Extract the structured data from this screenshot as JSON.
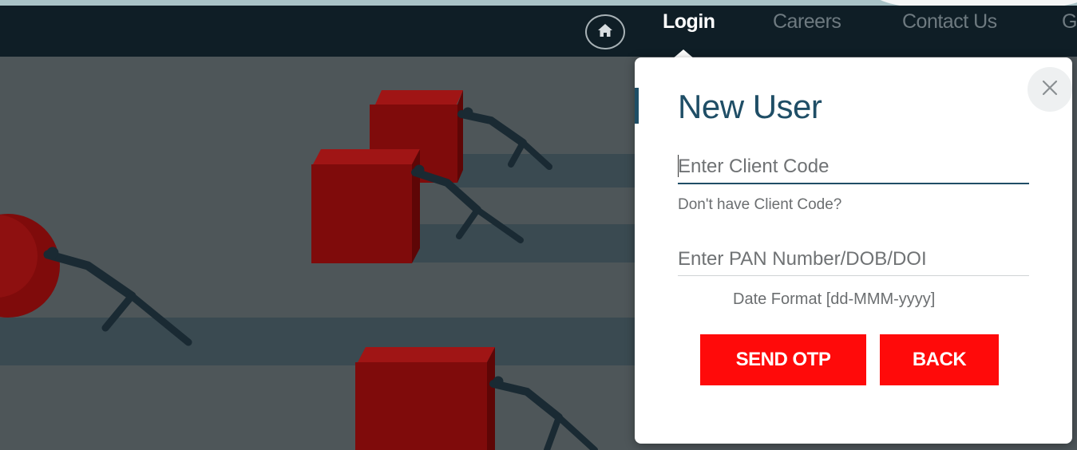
{
  "nav": {
    "items": [
      {
        "label": "Login",
        "active": true
      },
      {
        "label": "Careers",
        "active": false
      },
      {
        "label": "Contact Us",
        "active": false
      },
      {
        "label": "G",
        "active": false
      }
    ],
    "home_icon": "home-icon"
  },
  "popup": {
    "title": "New User",
    "client_code_placeholder": "Enter Client Code",
    "no_client_code_link": "Don't have Client Code?",
    "pan_placeholder": "Enter PAN Number/DOB/DOI",
    "date_format_note": "Date Format [dd-MMM-yyyy]",
    "send_otp_label": "SEND OTP",
    "back_label": "BACK",
    "close_icon": "close-icon"
  },
  "colors": {
    "navbar": "#0f1e26",
    "accent": "#1f4e66",
    "button": "#ff0a0a",
    "cube_red": "#8e0b0b"
  }
}
